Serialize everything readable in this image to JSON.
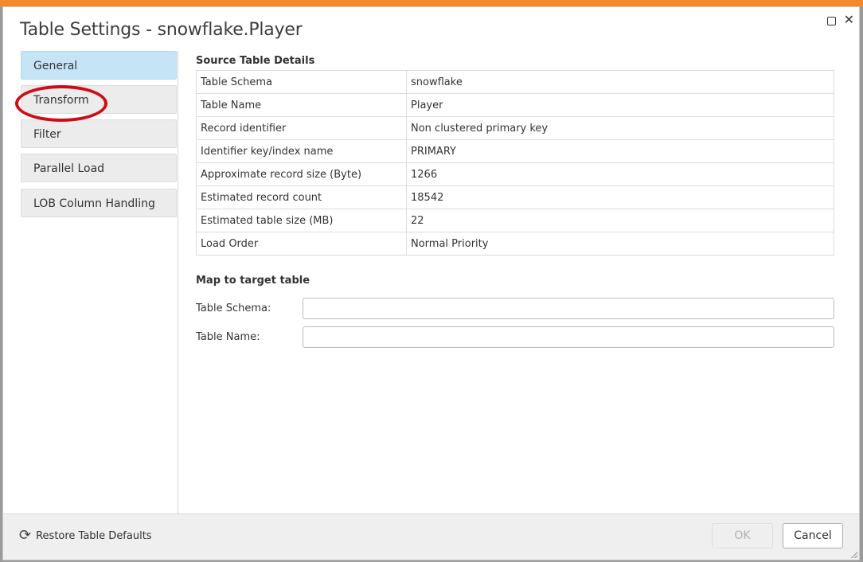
{
  "dialog": {
    "title": "Table Settings - snowflake.Player"
  },
  "sidebar": {
    "items": [
      {
        "label": "General",
        "active": true
      },
      {
        "label": "Transform",
        "active": false
      },
      {
        "label": "Filter",
        "active": false
      },
      {
        "label": "Parallel Load",
        "active": false
      },
      {
        "label": "LOB Column Handling",
        "active": false
      }
    ]
  },
  "source": {
    "title": "Source Table Details",
    "rows": [
      {
        "key": "Table Schema",
        "value": "snowflake"
      },
      {
        "key": "Table Name",
        "value": "Player"
      },
      {
        "key": "Record identifier",
        "value": "Non clustered primary key"
      },
      {
        "key": "Identifier key/index name",
        "value": "PRIMARY"
      },
      {
        "key": "Approximate record size (Byte)",
        "value": "1266"
      },
      {
        "key": "Estimated record count",
        "value": "18542"
      },
      {
        "key": "Estimated table size (MB)",
        "value": "22"
      },
      {
        "key": "Load Order",
        "value": "Normal Priority"
      }
    ]
  },
  "target": {
    "title": "Map to target table",
    "schema_label": "Table Schema:",
    "schema_value": "",
    "name_label": "Table Name:",
    "name_value": ""
  },
  "footer": {
    "restore_label": "Restore Table Defaults",
    "ok_label": "OK",
    "cancel_label": "Cancel"
  },
  "colors": {
    "accent_bar": "#f18a2f",
    "active_tab": "#c5e5f7",
    "highlight_ring": "#cc0d16"
  }
}
